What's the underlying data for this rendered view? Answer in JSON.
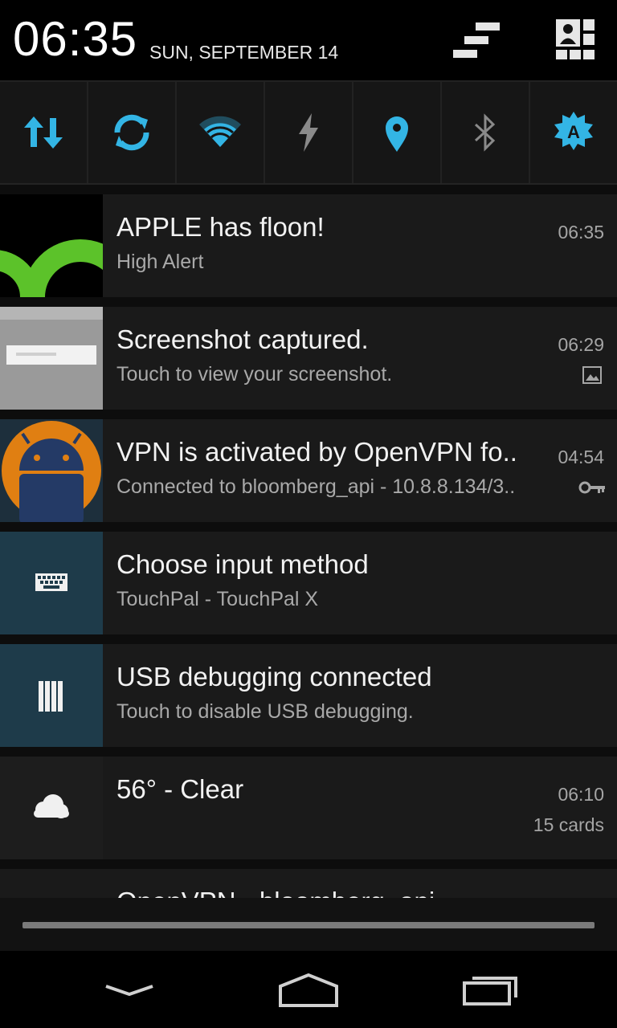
{
  "header": {
    "time": "06:35",
    "date": "SUN, SEPTEMBER 14",
    "icons": [
      "clear-all-icon",
      "user-settings-icon"
    ]
  },
  "quick_settings": [
    {
      "name": "mobile-data-icon",
      "active": true
    },
    {
      "name": "sync-icon",
      "active": true
    },
    {
      "name": "wifi-icon",
      "active": true
    },
    {
      "name": "flash-icon",
      "active": false
    },
    {
      "name": "location-icon",
      "active": true
    },
    {
      "name": "bluetooth-icon",
      "active": false
    },
    {
      "name": "auto-brightness-icon",
      "active": true
    }
  ],
  "notifications": [
    {
      "title": "APPLE has floon!",
      "text": "High Alert",
      "time": "06:35"
    },
    {
      "title": "Screenshot captured.",
      "text": "Touch to view your screenshot.",
      "time": "06:29",
      "icon": "image-icon"
    },
    {
      "title": "VPN is activated by OpenVPN fo..",
      "text": "Connected to bloomberg_api - 10.8.8.134/3..",
      "time": "04:54",
      "icon": "key-icon"
    },
    {
      "title": "Choose input method",
      "text": "TouchPal - TouchPal X"
    },
    {
      "title": "USB debugging connected",
      "text": "Touch to disable USB debugging."
    },
    {
      "title": "56° - Clear",
      "text": "",
      "time": "06:10",
      "info": "15 cards"
    },
    {
      "title": "OpenVPN - bloomberg_api"
    }
  ],
  "colors": {
    "accent": "#33b5e5",
    "inactive": "#8a8a8a",
    "card_bg": "#1a1a1a",
    "icon_bg": "#1e3b4a"
  },
  "navbar": [
    "back-icon",
    "home-icon",
    "recents-icon"
  ]
}
